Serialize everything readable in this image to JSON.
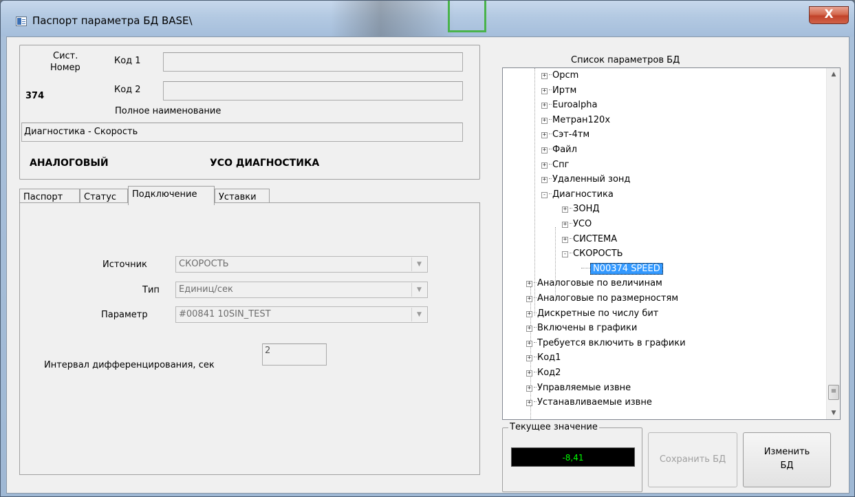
{
  "window": {
    "title": "Паспорт параметра БД BASE\\",
    "close_glyph": "X"
  },
  "passport": {
    "sys_label": "Сист.",
    "number_label": "Номер",
    "number_value": "374",
    "code1_label": "Код 1",
    "code1_value": "",
    "code2_label": "Код 2",
    "code2_value": "",
    "fullname_label": "Полное наименование",
    "fullname_value": "Диагностика - Скорость",
    "type_text": "АНАЛОГОВЫЙ",
    "uso_text": "УСО  ДИАГНОСТИКА"
  },
  "tabs": [
    {
      "label": "Паспорт"
    },
    {
      "label": "Статус"
    },
    {
      "label": "Подключение",
      "active": true
    },
    {
      "label": "Уставки"
    }
  ],
  "connection": {
    "source_label": "Источник",
    "source_value": "СКОРОСТЬ",
    "type_label": "Тип",
    "type_value": "Единиц/сек",
    "param_label": "Параметр",
    "param_value": "#00841 10SIN_TEST",
    "interval_label": "Интервал дифференцирования, сек",
    "interval_value": "2"
  },
  "tree": {
    "title": "Список параметров БД",
    "nodes": [
      {
        "label": "Opcm",
        "level": 1,
        "expander": "+"
      },
      {
        "label": "Иртм",
        "level": 1,
        "expander": "+"
      },
      {
        "label": "Euroalpha",
        "level": 1,
        "expander": "+"
      },
      {
        "label": "Метран120x",
        "level": 1,
        "expander": "+"
      },
      {
        "label": "Сэт-4тм",
        "level": 1,
        "expander": "+"
      },
      {
        "label": "Файл",
        "level": 1,
        "expander": "+"
      },
      {
        "label": "Спг",
        "level": 1,
        "expander": "+"
      },
      {
        "label": "Удаленный зонд",
        "level": 1,
        "expander": "+"
      },
      {
        "label": "Диагностика",
        "level": 1,
        "expander": "-"
      },
      {
        "label": "ЗОНД",
        "level": 2,
        "expander": "+"
      },
      {
        "label": "УСО",
        "level": 2,
        "expander": "+"
      },
      {
        "label": "СИСТЕМА",
        "level": 2,
        "expander": "+"
      },
      {
        "label": "СКОРОСТЬ",
        "level": 2,
        "expander": "-"
      },
      {
        "label": "N00374 SPEED",
        "level": 3,
        "expander": "",
        "selected": true
      },
      {
        "label": "Аналоговые по величинам",
        "level": 0,
        "expander": "+"
      },
      {
        "label": "Аналоговые по размерностям",
        "level": 0,
        "expander": "+"
      },
      {
        "label": "Дискретные по числу бит",
        "level": 0,
        "expander": "+"
      },
      {
        "label": "Включены в графики",
        "level": 0,
        "expander": "+"
      },
      {
        "label": "Требуется включить в графики",
        "level": 0,
        "expander": "+"
      },
      {
        "label": "Код1",
        "level": 0,
        "expander": "+"
      },
      {
        "label": "Код2",
        "level": 0,
        "expander": "+"
      },
      {
        "label": "Управляемые извне",
        "level": 0,
        "expander": "+"
      },
      {
        "label": "Устанавливаемые извне",
        "level": 0,
        "expander": "+"
      }
    ]
  },
  "current_value": {
    "legend": "Текущее значение",
    "value": "-8,41"
  },
  "buttons": {
    "save_db": "Сохранить БД",
    "change_db_line1": "Изменить",
    "change_db_line2": "БД"
  },
  "colors": {
    "value_fg": "#00ff00",
    "selection_bg": "#3399ff",
    "close_btn": "#c7432a"
  }
}
